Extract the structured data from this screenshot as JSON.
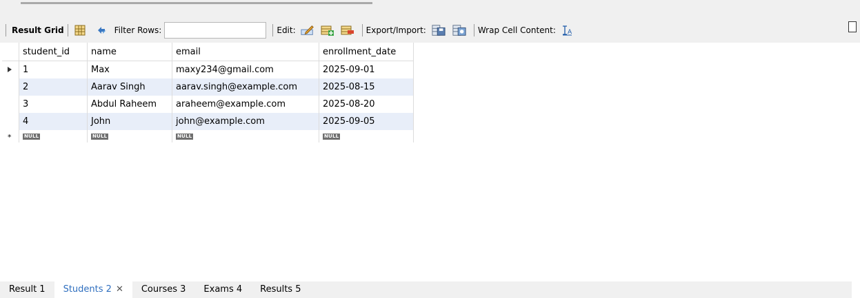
{
  "toolbar": {
    "result_grid_label": "Result Grid",
    "filter_rows_label": "Filter Rows:",
    "filter_rows_value": "",
    "edit_label": "Edit:",
    "export_import_label": "Export/Import:",
    "wrap_cell_label": "Wrap Cell Content:"
  },
  "grid": {
    "columns": [
      "student_id",
      "name",
      "email",
      "enrollment_date"
    ],
    "rows": [
      [
        "1",
        "Max",
        "maxy234@gmail.com",
        "2025-09-01"
      ],
      [
        "2",
        "Aarav Singh",
        "aarav.singh@example.com",
        "2025-08-15"
      ],
      [
        "3",
        "Abdul Raheem",
        "araheem@example.com",
        "2025-08-20"
      ],
      [
        "4",
        "John",
        "john@example.com",
        "2025-09-05"
      ]
    ],
    "null_label": "NULL"
  },
  "tabs": [
    {
      "label": "Result 1",
      "active": false
    },
    {
      "label": "Students 2",
      "active": true
    },
    {
      "label": "Courses 3",
      "active": false
    },
    {
      "label": "Exams 4",
      "active": false
    },
    {
      "label": "Results 5",
      "active": false
    }
  ],
  "colors": {
    "toolbar_bg": "#f0f0f0",
    "alt_row": "#e8eef9",
    "active_tab_text": "#2f6fbf",
    "null_badge": "#6f6f6f"
  },
  "icons": [
    "grid-layout-icon",
    "refresh-icon",
    "edit-row-icon",
    "add-row-icon",
    "delete-row-icon",
    "export-icon",
    "import-icon",
    "wrap-text-icon"
  ]
}
